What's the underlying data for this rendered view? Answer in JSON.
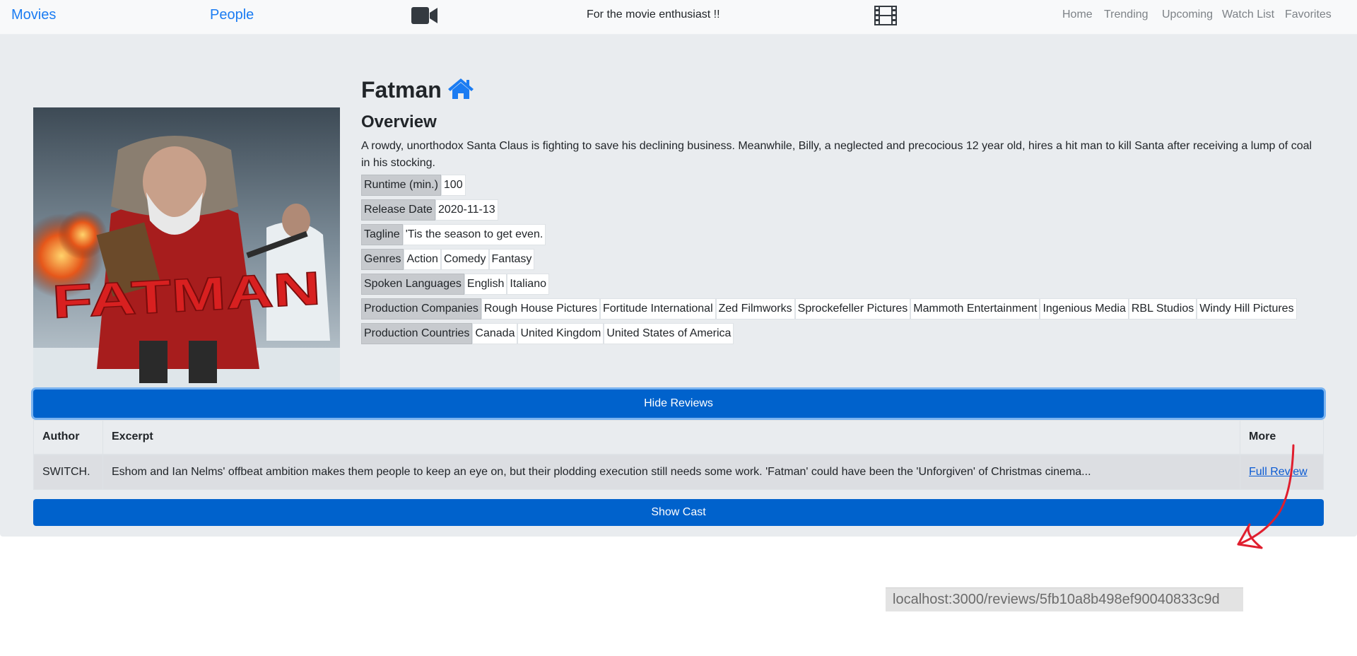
{
  "navbar": {
    "movies": "Movies",
    "people": "People",
    "tagline": "For the movie enthusiast !!",
    "icons": [
      "video-camera-icon",
      "film-icon"
    ],
    "links": [
      "Home",
      "Trending",
      "Upcoming",
      "Watch List",
      "Favorites"
    ],
    "link_color": "#1b7cf2"
  },
  "movie": {
    "title": "Fatman",
    "poster_text": "FATMAN",
    "overview_heading": "Overview",
    "overview": "A rowdy, unorthodox Santa Claus is fighting to save his declining business. Meanwhile, Billy, a neglected and precocious 12 year old, hires a hit man to kill Santa after receiving a lump of coal in his stocking.",
    "attributes": {
      "runtime": {
        "label": "Runtime (min.)",
        "value": "100"
      },
      "release": {
        "label": "Release Date",
        "value": "2020-11-13"
      },
      "tagline": {
        "label": "Tagline",
        "value": "'Tis the season to get even."
      },
      "genres": {
        "label": "Genres",
        "values": [
          "Action",
          "Comedy",
          "Fantasy"
        ]
      },
      "languages": {
        "label": "Spoken Languages",
        "values": [
          "English",
          "Italiano"
        ]
      },
      "companies": {
        "label": "Production Companies",
        "values": [
          "Rough House Pictures",
          "Fortitude International",
          "Zed Filmworks",
          "Sprockefeller Pictures",
          "Mammoth Entertainment",
          "Ingenious Media",
          "RBL Studios",
          "Windy Hill Pictures"
        ]
      },
      "countries": {
        "label": "Production Countries",
        "values": [
          "Canada",
          "United Kingdom",
          "United States of America"
        ]
      }
    }
  },
  "reviews": {
    "toggle_label": "Hide Reviews",
    "columns": [
      "Author",
      "Excerpt",
      "More"
    ],
    "rows": [
      {
        "author": "SWITCH.",
        "excerpt": "Eshom and Ian Nelms' offbeat ambition makes them people to keep an eye on, but their plodding execution still needs some work. 'Fatman' could have been the 'Unforgiven' of Christmas cinema...",
        "more": "Full Review"
      }
    ]
  },
  "cast": {
    "toggle_label": "Show Cast"
  },
  "annotation": {
    "url": "localhost:3000/reviews/5fb10a8b498ef90040833c9d",
    "arrow_color": "#e01e2e"
  }
}
